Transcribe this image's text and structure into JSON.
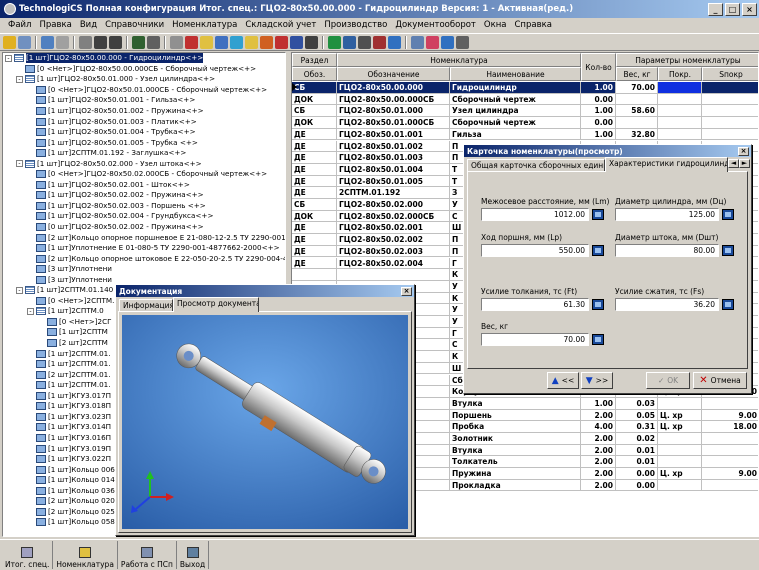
{
  "title": "TechnologiCS Полная конфигурация Итог. спец.: ГЦО2-80х50.00.000 - Гидроцилиндр Версия: 1 - Активная(ред.)",
  "menu": [
    "Файл",
    "Правка",
    "Вид",
    "Справочники",
    "Номенклатура",
    "Складской учет",
    "Производство",
    "Документооборот",
    "Окна",
    "Справка"
  ],
  "window_buttons": {
    "minimize": "_",
    "maximize": "□",
    "close": "×"
  },
  "tree": [
    {
      "indent": 0,
      "box": "-",
      "icon": "list",
      "text": "[1 шт]ГЦО2-80х50.00.000 - Гидроцилиндр<+>",
      "sel": true
    },
    {
      "indent": 1,
      "box": "",
      "icon": "doc",
      "text": "[0 <Нет>]ГЦО2-80х50.00.000СБ - Сборочный чертеж<+>"
    },
    {
      "indent": 1,
      "box": "-",
      "icon": "list",
      "text": "[1 шт]ГЦО2-80х50.01.000 - Узел цилиндра<+>"
    },
    {
      "indent": 2,
      "box": "",
      "icon": "doc",
      "text": "[0 <Нет>]ГЦО2-80х50.01.000СБ - Сборочный чертеж<+>"
    },
    {
      "indent": 2,
      "box": "",
      "icon": "doc",
      "text": "[1 шт]ГЦО2-80х50.01.001 - Гильза<+>"
    },
    {
      "indent": 2,
      "box": "",
      "icon": "doc",
      "text": "[1 шт]ГЦО2-80х50.01.002 - Пружина<+>"
    },
    {
      "indent": 2,
      "box": "",
      "icon": "doc",
      "text": "[1 шт]ГЦО2-80х50.01.003 - Платик<+>"
    },
    {
      "indent": 2,
      "box": "",
      "icon": "doc",
      "text": "[1 шт]ГЦО2-80х50.01.004 - Трубка<+>"
    },
    {
      "indent": 2,
      "box": "",
      "icon": "doc",
      "text": "[1 шт]ГЦО2-80х50.01.005 - Трубка <+>"
    },
    {
      "indent": 2,
      "box": "",
      "icon": "doc",
      "text": "[1 шт]2СПТМ.01.192 - Заглушка<+>"
    },
    {
      "indent": 1,
      "box": "-",
      "icon": "list",
      "text": "[1 шт]ГЦО2-80х50.02.000 - Узел штока<+>"
    },
    {
      "indent": 2,
      "box": "",
      "icon": "doc",
      "text": "[0 <Нет>]ГЦО2-80х50.02.000СБ - Сборочный чертеж<+>"
    },
    {
      "indent": 2,
      "box": "",
      "icon": "doc",
      "text": "[1 шт]ГЦО2-80х50.02.001 - Шток<+>"
    },
    {
      "indent": 2,
      "box": "",
      "icon": "doc",
      "text": "[1 шт]ГЦО2-80х50.02.002 - Пружина<+>"
    },
    {
      "indent": 2,
      "box": "",
      "icon": "doc",
      "text": "[1 шт]ГЦО2-80х50.02.003 - Поршень <+>"
    },
    {
      "indent": 2,
      "box": "",
      "icon": "doc",
      "text": "[1 шт]ГЦО2-80х50.02.004 - Грундбукса<+>"
    },
    {
      "indent": 2,
      "box": "",
      "icon": "doc",
      "text": "[0 шт]ГЦО2-80х50.02.002 - Пружина<+>"
    },
    {
      "indent": 2,
      "box": "",
      "icon": "doc",
      "text": "[2 шт]Кольцо опорное поршневое Е 21-080-12-2.5 ТУ 2290-001-4"
    },
    {
      "indent": 2,
      "box": "",
      "icon": "doc",
      "text": "[1 шт]Уплотнение Е 01-080-5 ТУ 2290-001-4877662-2000<+>"
    },
    {
      "indent": 2,
      "box": "",
      "icon": "doc",
      "text": "[2 шт]Кольцо опорное штоковое Е 22-050-20-2.5 ТУ 2290-004-48"
    },
    {
      "indent": 2,
      "box": "",
      "icon": "doc",
      "text": "[3 шт]Уплотнени"
    },
    {
      "indent": 2,
      "box": "",
      "icon": "doc",
      "text": "[3 шт]Уплотнени"
    },
    {
      "indent": 1,
      "box": "-",
      "icon": "list",
      "text": "[1 шт]2СПТМ.01.140"
    },
    {
      "indent": 2,
      "box": "",
      "icon": "doc",
      "text": "[0 <Нет>]2СПТМ."
    },
    {
      "indent": 2,
      "box": "-",
      "icon": "list",
      "text": "[1 шт]2СПТМ.0"
    },
    {
      "indent": 3,
      "box": "",
      "icon": "doc",
      "text": "[0 <Нет>]2СГ"
    },
    {
      "indent": 3,
      "box": "",
      "icon": "doc",
      "text": "[1 шт]2СПТМ"
    },
    {
      "indent": 3,
      "box": "",
      "icon": "doc",
      "text": "[2 шт]2СПТМ"
    },
    {
      "indent": 2,
      "box": "",
      "icon": "doc",
      "text": "[1 шт]2СПТМ.01."
    },
    {
      "indent": 2,
      "box": "",
      "icon": "doc",
      "text": "[1 шт]2СПТМ.01."
    },
    {
      "indent": 2,
      "box": "",
      "icon": "doc",
      "text": "[2 шт]2СПТМ.01."
    },
    {
      "indent": 2,
      "box": "",
      "icon": "doc",
      "text": "[1 шт]2СПТМ.01."
    },
    {
      "indent": 2,
      "box": "",
      "icon": "doc",
      "text": "[1 шт]КГУ3.017П"
    },
    {
      "indent": 2,
      "box": "",
      "icon": "doc",
      "text": "[1 шт]КГУ3.018П"
    },
    {
      "indent": 2,
      "box": "",
      "icon": "doc",
      "text": "[1 шт]КГУ3.023П"
    },
    {
      "indent": 2,
      "box": "",
      "icon": "doc",
      "text": "[1 шт]КГУ3.014П"
    },
    {
      "indent": 2,
      "box": "",
      "icon": "doc",
      "text": "[1 шт]КГУ3.016П"
    },
    {
      "indent": 2,
      "box": "",
      "icon": "doc",
      "text": "[1 шт]КГУ3.019П"
    },
    {
      "indent": 2,
      "box": "",
      "icon": "doc",
      "text": "[1 шт]КГУ3.022П"
    },
    {
      "indent": 2,
      "box": "",
      "icon": "doc",
      "text": "[1 шт]Кольцо 006"
    },
    {
      "indent": 2,
      "box": "",
      "icon": "doc",
      "text": "[1 шт]Кольцо 014"
    },
    {
      "indent": 2,
      "box": "",
      "icon": "doc",
      "text": "[1 шт]Кольцо 036"
    },
    {
      "indent": 2,
      "box": "",
      "icon": "doc",
      "text": "[2 шт]Кольцо 020-025-36-2-0 ГОСТ 18829-73<+>"
    },
    {
      "indent": 2,
      "box": "",
      "icon": "doc",
      "text": "[2 шт]Кольцо 025-030-36-2-0 ГОСТ 18829-73<+>"
    },
    {
      "indent": 2,
      "box": "",
      "icon": "doc",
      "text": "[1 шт]Кольцо 058-063-36-2-0 ГОСТ 18829-73<+>"
    }
  ],
  "grid": {
    "h_razdel": "Раздел",
    "h_nomen": "Номенклатура",
    "h_kolvo": "Кол-во",
    "h_params": "Параметры номенклатуры",
    "h_obozn_short": "Обоз.",
    "h_oboznachenie": "Обозначение",
    "h_naimenovanie": "Наименование",
    "h_ves": "Вес, кг",
    "h_pokr": "Покр.",
    "h_sprokr": "Sпокр",
    "rows": [
      [
        "СБ",
        "ГЦО2-80х50.00.000",
        "Гидроцилиндр",
        "1.00",
        "70.00",
        "",
        ""
      ],
      [
        "ДОК",
        "ГЦО2-80х50.00.000СБ",
        "Сборочный чертеж",
        "0.00",
        "",
        "",
        ""
      ],
      [
        "СБ",
        "ГЦО2-80х50.01.000",
        "Узел цилиндра",
        "1.00",
        "58.60",
        "",
        ""
      ],
      [
        "ДОК",
        "ГЦО2-80х50.01.000СБ",
        "Сборочный чертеж",
        "0.00",
        "",
        "",
        ""
      ],
      [
        "ДЕ",
        "ГЦО2-80х50.01.001",
        "Гильза",
        "1.00",
        "32.80",
        "",
        ""
      ],
      [
        "ДЕ",
        "ГЦО2-80х50.01.002",
        "П",
        "",
        "",
        "",
        ""
      ],
      [
        "ДЕ",
        "ГЦО2-80х50.01.003",
        "П",
        "",
        "",
        "",
        ""
      ],
      [
        "ДЕ",
        "ГЦО2-80х50.01.004",
        "Т",
        "",
        "",
        "",
        ""
      ],
      [
        "ДЕ",
        "ГЦО2-80х50.01.005",
        "Т",
        "",
        "",
        "",
        ""
      ],
      [
        "ДЕ",
        "2СПТМ.01.192",
        "З",
        "",
        "",
        "",
        ""
      ],
      [
        "СБ",
        "ГЦО2-80х50.02.000",
        "У",
        "",
        "",
        "",
        ""
      ],
      [
        "ДОК",
        "ГЦО2-80х50.02.000СБ",
        "С",
        "",
        "",
        "",
        ""
      ],
      [
        "ДЕ",
        "ГЦО2-80х50.02.001",
        "Ш",
        "",
        "",
        "",
        ""
      ],
      [
        "ДЕ",
        "ГЦО2-80х50.02.002",
        "П",
        "",
        "",
        "",
        ""
      ],
      [
        "ДЕ",
        "ГЦО2-80х50.02.003",
        "П",
        "",
        "",
        "",
        ""
      ],
      [
        "ДЕ",
        "ГЦО2-80х50.02.004",
        "Г",
        "",
        "",
        "",
        ""
      ],
      [
        "",
        "",
        "К",
        "",
        "",
        "",
        ""
      ],
      [
        "",
        "",
        "У",
        "",
        "",
        "",
        ""
      ],
      [
        "",
        "",
        "К",
        "",
        "",
        "",
        ""
      ],
      [
        "",
        "",
        "У",
        "",
        "",
        "",
        ""
      ],
      [
        "",
        "",
        "У",
        "",
        "",
        "",
        ""
      ],
      [
        "",
        "",
        "Г",
        "",
        "",
        "",
        ""
      ],
      [
        "",
        "",
        "С",
        "",
        "",
        "",
        ""
      ],
      [
        "",
        "",
        "К",
        "",
        "",
        "",
        ""
      ],
      [
        "",
        "",
        "Ш",
        "",
        "",
        "",
        ""
      ],
      [
        "",
        "",
        "Сборочный чертеж",
        "",
        "",
        "",
        ""
      ],
      [
        "",
        "",
        "Корпус",
        "1.00",
        "3.78",
        "Ц. хр",
        "18.00"
      ],
      [
        "",
        "",
        "Втулка",
        "1.00",
        "0.03",
        "",
        ""
      ],
      [
        "",
        "",
        "Поршень",
        "2.00",
        "0.05",
        "Ц. хр",
        "9.00"
      ],
      [
        "",
        "",
        "Пробка",
        "4.00",
        "0.31",
        "Ц. хр",
        "18.00"
      ],
      [
        "",
        "",
        "Золотник",
        "2.00",
        "0.02",
        "",
        ""
      ],
      [
        "",
        "",
        "Втулка",
        "2.00",
        "0.01",
        "",
        ""
      ],
      [
        "",
        "",
        "Толкатель",
        "2.00",
        "0.01",
        "",
        ""
      ],
      [
        "",
        "",
        "Пружина",
        "2.00",
        "0.00",
        "Ц. хр",
        "9.00"
      ],
      [
        "",
        "",
        "Прокладка",
        "2.00",
        "0.00",
        "",
        ""
      ]
    ]
  },
  "doc_window": {
    "title": "Документация",
    "tab_info": "Информация",
    "tab_view": "Просмотр документа",
    "axes": {
      "x": "x",
      "y": "y",
      "z": "z"
    }
  },
  "card": {
    "title": "Карточка номенклатуры(просмотр)",
    "tab1": "Общая карточка сборочных единиц",
    "tab2": "Характеристики гидроцилиндра",
    "label_lm": "Межосевое расстояние, мм (Lm)",
    "val_lm": "1012.00",
    "label_dc": "Диаметр цилиндра, мм (Dц)",
    "val_dc": "125.00",
    "label_lp": "Ход поршня, мм (Lp)",
    "val_lp": "550.00",
    "label_dsh": "Диаметр штока, мм (Dшт)",
    "val_dsh": "80.00",
    "label_ft": "Усилие толкания, тс (Ft)",
    "val_ft": "61.30",
    "label_fs": "Усилие сжатия, тс (Fs)",
    "val_fs": "36.20",
    "label_ves": "Вес, кг",
    "val_ves": "70.00",
    "btn_prev": "<<",
    "btn_next": ">>",
    "btn_ok": "OK",
    "btn_cancel": "Отмена"
  },
  "statusbar": [
    "Итог. спец.",
    "Номенклатура",
    "Работа с ПСп",
    "Выход"
  ],
  "colors": {
    "title_start": "#0a246a",
    "title_end": "#a6caf0",
    "selection": "#0a246a",
    "face": "#d4d0c8",
    "viewer_bg": "#3b78c8"
  }
}
